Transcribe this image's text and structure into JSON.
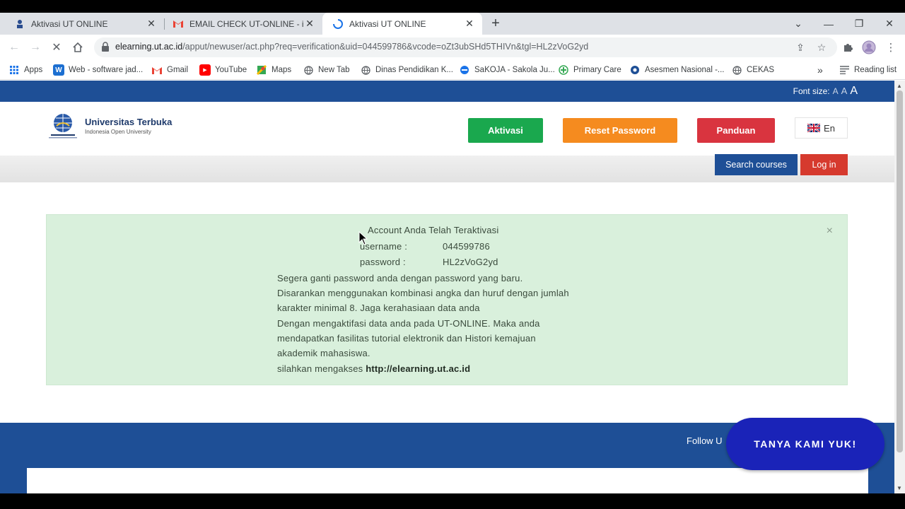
{
  "browser": {
    "tabs": [
      {
        "title": "Aktivasi UT ONLINE"
      },
      {
        "title": "EMAIL CHECK UT-ONLINE - iman"
      },
      {
        "title": "Aktivasi UT ONLINE"
      }
    ],
    "url_host": "elearning.ut.ac.id",
    "url_rest": "/apput/newuser/act.php?req=verification&uid=044599786&vcode=oZt3ubSHd5THIVn&tgl=HL2zVoG2yd",
    "bookmarks": [
      {
        "label": "Apps"
      },
      {
        "label": "Web - software jad..."
      },
      {
        "label": "Gmail"
      },
      {
        "label": "YouTube"
      },
      {
        "label": "Maps"
      },
      {
        "label": "New Tab"
      },
      {
        "label": "Dinas Pendidikan K..."
      },
      {
        "label": "SaKOJA - Sakola Ju..."
      },
      {
        "label": "Primary Care"
      },
      {
        "label": "Asesmen Nasional -..."
      },
      {
        "label": "CEKAS"
      }
    ],
    "reading_list": "Reading list",
    "more_bookmarks": "»"
  },
  "site": {
    "font_size_label": "Font size:",
    "font_size_options": [
      "A",
      "A",
      "A"
    ],
    "logo_title": "Universitas Terbuka",
    "logo_subtitle": "Indonesia Open University",
    "nav": {
      "aktivasi": "Aktivasi",
      "reset": "Reset Password",
      "panduan": "Panduan",
      "lang": "En"
    },
    "search_courses": "Search courses",
    "login": "Log in",
    "alert": {
      "heading": "Account Anda Telah Teraktivasi",
      "username_label": "username :",
      "username_value": "044599786",
      "password_label": "password :",
      "password_value": "HL2zVoG2yd",
      "line1": "Segera ganti password anda dengan password yang baru.",
      "line2": "Disarankan menggunakan kombinasi angka dan huruf dengan jumlah",
      "line3": "karakter minimal 8. Jaga kerahasiaan data anda",
      "line4": "Dengan mengaktifasi data anda pada UT-ONLINE. Maka anda",
      "line5": "mendapatkan fasilitas tutorial elektronik dan Histori kemajuan",
      "line6": "akademik mahasiswa.",
      "access_prefix": "silahkan mengakses",
      "access_link": "http://elearning.ut.ac.id",
      "close": "×"
    },
    "follow": "Follow U",
    "chat_button": "TANYA KAMI YUK!"
  },
  "colors": {
    "aktivasi": "#1aa84e",
    "reset": "#f58b1f",
    "panduan": "#d9343f",
    "search": "#1e4f96",
    "login": "#d63a2e",
    "brand": "#1e4f96",
    "alert_bg": "#d9f0dc",
    "chat": "#1a23b8"
  }
}
